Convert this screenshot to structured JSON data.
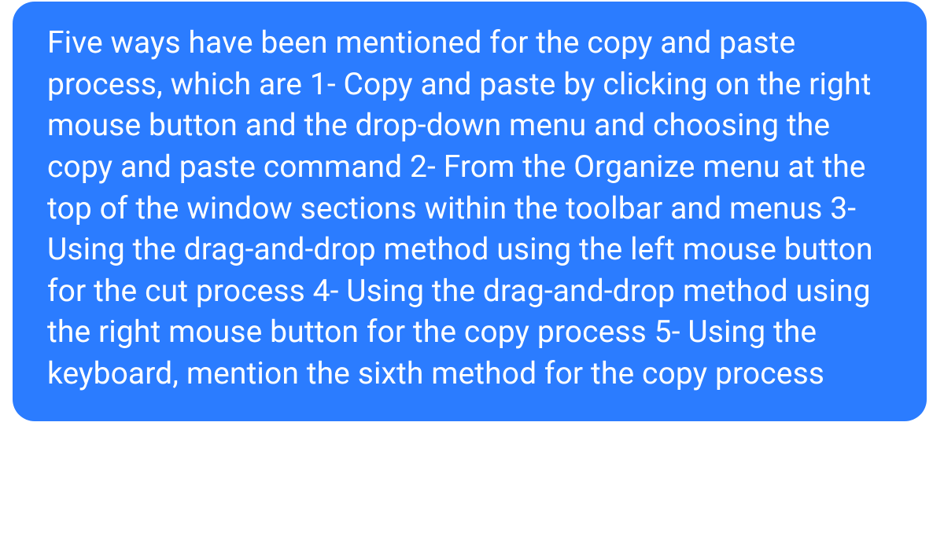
{
  "message": {
    "text": "Five ways have been mentioned for the copy and paste process, which are 1- Copy and paste by clicking on the right mouse button and the drop-down menu and choosing the copy and paste command 2- From the Organize menu at the top of the window sections within the toolbar and menus 3- Using the drag-and-drop method using the left mouse button for the cut process 4-  Using the drag-and-drop method using the right mouse button for the copy process 5- Using the keyboard, mention the sixth method for the copy process"
  },
  "colors": {
    "bubble_background": "#2b7cff",
    "bubble_text": "#ffffff",
    "page_background": "#ffffff"
  }
}
